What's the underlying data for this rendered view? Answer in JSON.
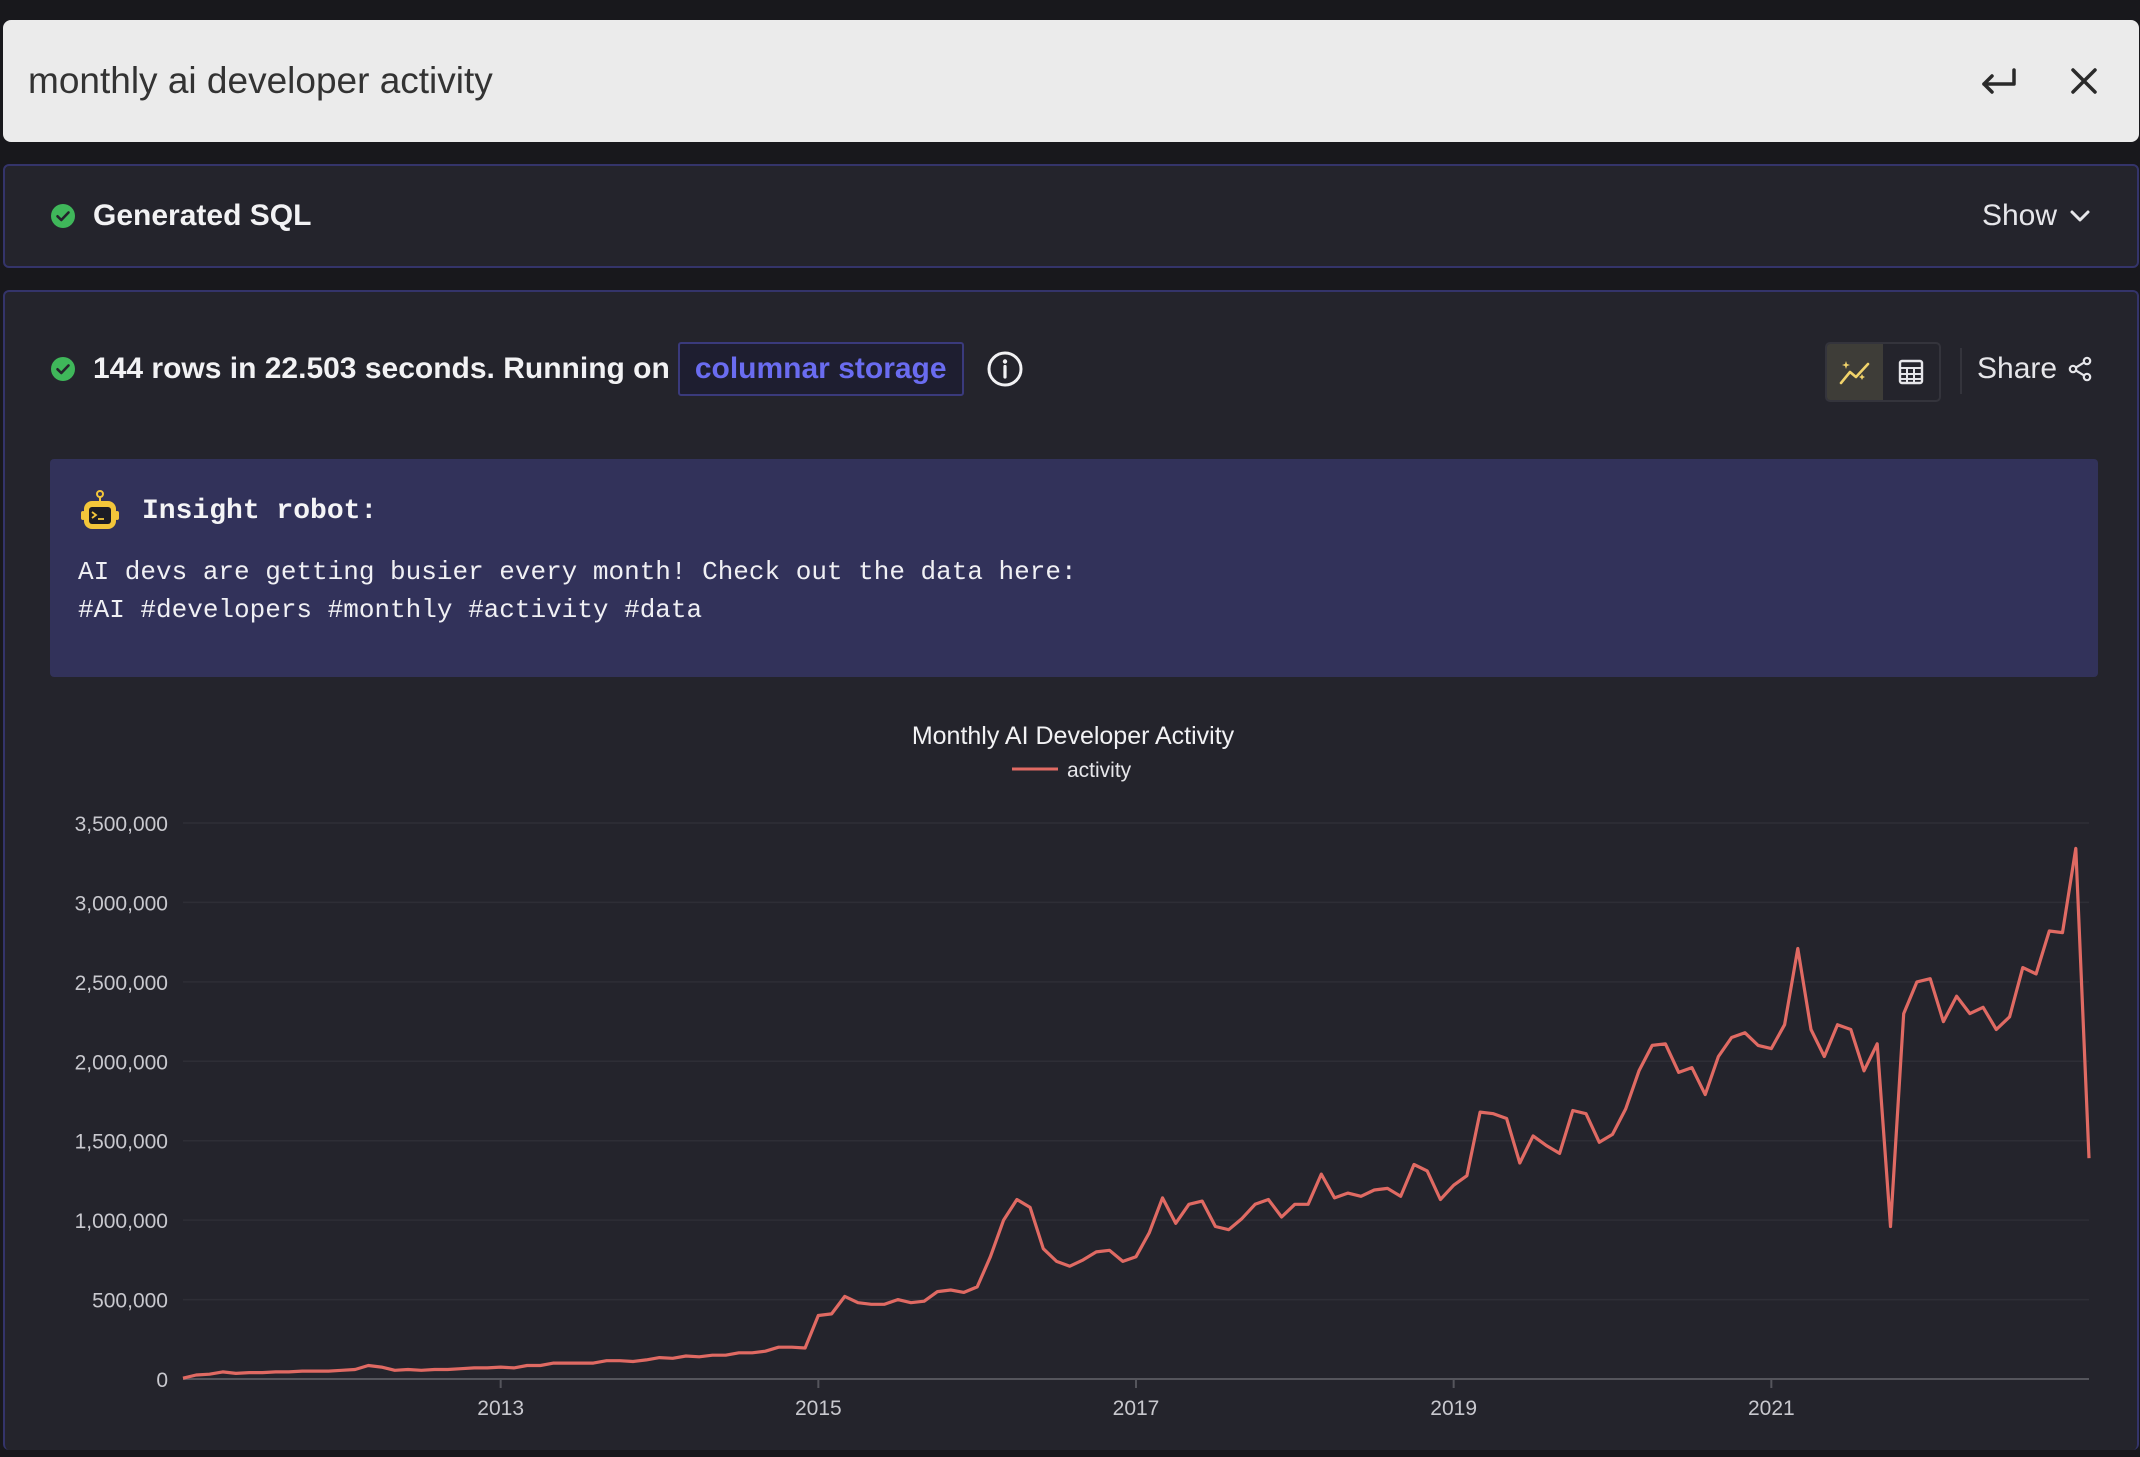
{
  "search": {
    "query": "monthly ai developer activity"
  },
  "sql_panel": {
    "title": "Generated SQL",
    "toggle_label": "Show"
  },
  "result": {
    "status": "144 rows in 22.503 seconds. Running on",
    "storage": "columnar storage",
    "share_label": "Share"
  },
  "insight": {
    "title": "Insight robot:",
    "body": "AI devs are getting busier every month! Check out the data here:\n#AI #developers #monthly #activity #data"
  },
  "colors": {
    "line": "#e06a63",
    "accent": "#6a6cf0",
    "success": "#3fb75a"
  },
  "chart_data": {
    "type": "line",
    "title": "Monthly AI Developer Activity",
    "legend": "top",
    "grid": true,
    "x_start": "2011-01",
    "ylim": [
      0,
      3500000
    ],
    "yticks": [
      0,
      500000,
      1000000,
      1500000,
      2000000,
      2500000,
      3000000,
      3500000
    ],
    "ytick_labels": [
      "0",
      "500,000",
      "1,000,000",
      "1,500,000",
      "2,000,000",
      "2,500,000",
      "3,000,000",
      "3,500,000"
    ],
    "xticks": [
      "2013",
      "2015",
      "2017",
      "2019",
      "2021"
    ],
    "xtick_positions": [
      "2013-01",
      "2015-01",
      "2017-01",
      "2019-01",
      "2021-01"
    ],
    "series": [
      {
        "name": "activity",
        "values": [
          5000,
          25000,
          30000,
          45000,
          35000,
          40000,
          40000,
          45000,
          45000,
          50000,
          50000,
          50000,
          55000,
          60000,
          85000,
          75000,
          55000,
          60000,
          55000,
          60000,
          60000,
          65000,
          70000,
          70000,
          75000,
          70000,
          85000,
          85000,
          100000,
          100000,
          100000,
          100000,
          115000,
          115000,
          110000,
          120000,
          135000,
          130000,
          145000,
          140000,
          150000,
          150000,
          165000,
          165000,
          175000,
          200000,
          200000,
          195000,
          400000,
          410000,
          520000,
          480000,
          470000,
          470000,
          500000,
          480000,
          490000,
          550000,
          560000,
          545000,
          580000,
          770000,
          1000000,
          1130000,
          1080000,
          820000,
          740000,
          710000,
          750000,
          800000,
          810000,
          740000,
          770000,
          920000,
          1140000,
          980000,
          1100000,
          1120000,
          960000,
          940000,
          1010000,
          1100000,
          1130000,
          1020000,
          1100000,
          1100000,
          1290000,
          1140000,
          1170000,
          1150000,
          1190000,
          1200000,
          1150000,
          1350000,
          1310000,
          1130000,
          1220000,
          1280000,
          1680000,
          1670000,
          1640000,
          1360000,
          1530000,
          1470000,
          1420000,
          1690000,
          1670000,
          1490000,
          1540000,
          1700000,
          1940000,
          2100000,
          2110000,
          1930000,
          1960000,
          1790000,
          2030000,
          2150000,
          2180000,
          2100000,
          2080000,
          2230000,
          2710000,
          2200000,
          2030000,
          2230000,
          2200000,
          1940000,
          2110000,
          960000,
          2300000,
          2500000,
          2520000,
          2250000,
          2410000,
          2300000,
          2340000,
          2200000,
          2280000,
          2590000,
          2550000,
          2820000,
          2810000,
          3340000,
          1390000
        ]
      }
    ]
  }
}
